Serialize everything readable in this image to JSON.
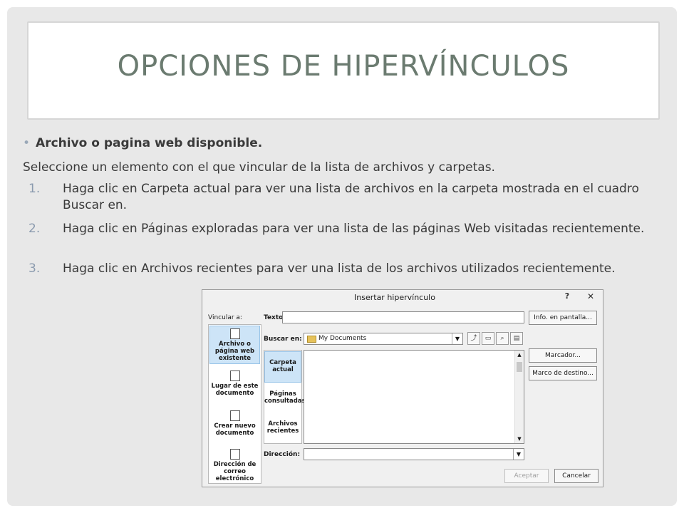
{
  "slide": {
    "title": "OPCIONES DE HIPERVÍNCULOS",
    "bullet": "Archivo o pagina web disponible.",
    "intro": "Seleccione un elemento con el que vincular de la lista de archivos y carpetas.",
    "steps": [
      {
        "num": "1.",
        "text": "Haga clic en Carpeta actual para ver una lista de archivos en la carpeta mostrada en el cuadro Buscar en."
      },
      {
        "num": "2.",
        "text": " Haga clic en Páginas exploradas para ver una lista de las páginas Web visitadas recientemente."
      },
      {
        "num": "3.",
        "text": " Haga clic en Archivos recientes para ver una lista de los archivos utilizados recientemente."
      }
    ]
  },
  "dialog": {
    "title": "Insertar hipervínculo",
    "help": "?",
    "close": "✕",
    "vincular_label": "Vincular a:",
    "sidebar": [
      {
        "label": "Archivo o página web existente"
      },
      {
        "label": "Lugar de este documento"
      },
      {
        "label": "Crear nuevo documento"
      },
      {
        "label": "Dirección de correo electrónico"
      }
    ],
    "texto_label": "Texto:",
    "texto_value": "",
    "buscar_label": "Buscar en:",
    "buscar_value": "My Documents",
    "folders": [
      {
        "label": "Carpeta actual"
      },
      {
        "label": "Páginas consultadas"
      },
      {
        "label": "Archivos recientes"
      }
    ],
    "direccion_label": "Dirección:",
    "direccion_value": "",
    "buttons": {
      "info": "Info. en pantalla...",
      "marcador": "Marcador...",
      "marco": "Marco de destino...",
      "aceptar": "Aceptar",
      "cancelar": "Cancelar"
    }
  },
  "colors": {
    "slide_bg": "#e8e8e8",
    "title_color": "#6b7b70",
    "selected_bg": "#cde4f7"
  }
}
